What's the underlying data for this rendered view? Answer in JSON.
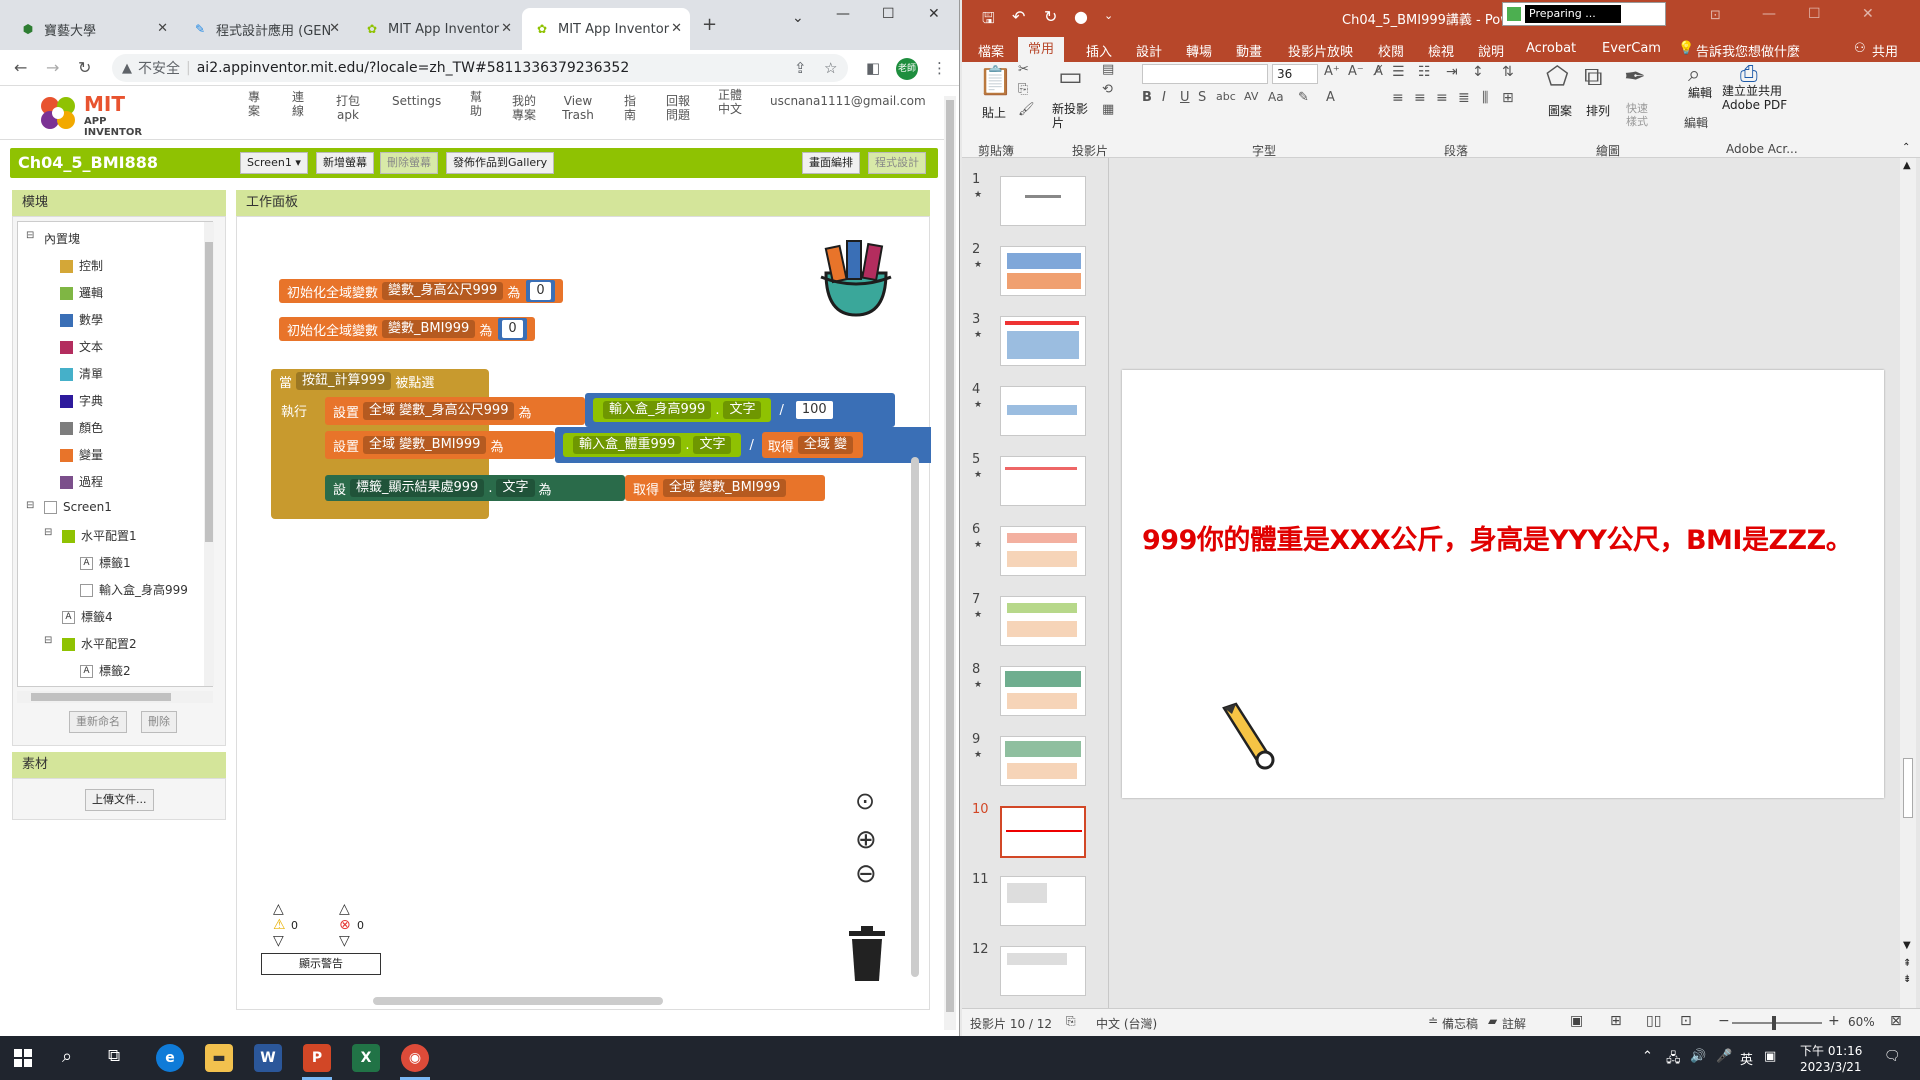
{
  "chrome": {
    "tabs": [
      {
        "label": "寶藝大學"
      },
      {
        "label": "程式設計應用 (GEN"
      },
      {
        "label": "MIT App Inventor"
      },
      {
        "label": "MIT App Inventor"
      }
    ],
    "new_tab": "+",
    "url": "ai2.appinventor.mit.edu/?locale=zh_TW#5811336379236352",
    "insecure": "不安全",
    "profile": "老師"
  },
  "ai": {
    "logo_main": "MIT",
    "logo_sub": "APP INVENTOR",
    "menu": [
      "專案",
      "連線",
      "打包apk",
      "Settings",
      "幫助",
      "我的專案",
      "View Trash",
      "指南",
      "回報問題",
      "正體中文"
    ],
    "email": "uscnana1111@gmail.com",
    "project_name": "Ch04_5_BMI888",
    "screen_select": "Screen1 ▾",
    "add_screen": "新增螢幕",
    "remove_screen": "刪除螢幕",
    "publish": "發佈作品到Gallery",
    "designer": "畫面編排",
    "blocks_btn": "程式設計",
    "blocks_panel_title": "模塊",
    "workspace_title": "工作面板",
    "tree": {
      "builtin": "內置塊",
      "categories": [
        {
          "label": "控制",
          "color": "#d4a737"
        },
        {
          "label": "邏輯",
          "color": "#7fb644"
        },
        {
          "label": "數學",
          "color": "#3a6fb6"
        },
        {
          "label": "文本",
          "color": "#b32d5e"
        },
        {
          "label": "清單",
          "color": "#45b0c9"
        },
        {
          "label": "字典",
          "color": "#2d1a9c"
        },
        {
          "label": "顏色",
          "color": "#7d7d7d"
        },
        {
          "label": "變量",
          "color": "#e8742a"
        },
        {
          "label": "過程",
          "color": "#7b4f8b"
        }
      ],
      "screen": "Screen1",
      "components": [
        "水平配置1",
        "標籤1",
        "輸入盒_身高999",
        "標籤4",
        "水平配置2",
        "標籤2"
      ]
    },
    "rename": "重新命名",
    "delete": "刪除",
    "media_title": "素材",
    "upload": "上傳文件...",
    "warn_count": "0",
    "error_count": "0",
    "show_warnings": "顯示警告",
    "blocks": {
      "init_global": "初始化全域變數",
      "var_height": "變數_身高公尺999",
      "as": "為",
      "zero": "0",
      "var_bmi": "變數_BMI999",
      "when": "當",
      "button": "按鈕_計算999",
      "clicked": "被點選",
      "do": "執行",
      "set": "設置",
      "global_height": "全域 變數_身高公尺999",
      "input_height": "輸入盒_身高999",
      "text": "文字",
      "divide": "/",
      "hundred": "100",
      "global_bmi": "全域 變數_BMI999",
      "input_weight": "輸入盒_體重999",
      "get": "取得",
      "global_trunc": "全域 變",
      "set_short": "設",
      "label_result": "標籤_顯示結果處999",
      "get_global_bmi": "全域 變數_BMI999"
    }
  },
  "ppt": {
    "title": "Ch04_5_BMI999講義 - Pow",
    "preparing": "Preparing ...",
    "menu": [
      "檔案",
      "常用",
      "插入",
      "設計",
      "轉場",
      "動畫",
      "投影片放映",
      "校閱",
      "檢視",
      "說明",
      "Acrobat",
      "EverCam"
    ],
    "tell_me": "告訴我您想做什麼",
    "share": "共用",
    "groups": [
      "剪貼簿",
      "投影片",
      "字型",
      "段落",
      "繪圖",
      "編輯",
      "Adobe Acr..."
    ],
    "paste": "貼上",
    "new_slide": "新投影片",
    "shapes": "圖案",
    "arrange": "排列",
    "quick_styles": "快速樣式",
    "edit": "編輯",
    "adobe": "建立並共用 Adobe PDF",
    "font_size": "36",
    "slides": [
      "1",
      "2",
      "3",
      "4",
      "5",
      "6",
      "7",
      "8",
      "9",
      "10",
      "11",
      "12"
    ],
    "slide_text": "999你的體重是XXX公斤，身高是YYY公尺，BMI是ZZZ。",
    "status_slide": "投影片 10 / 12",
    "status_lang": "中文 (台灣)",
    "notes": "備忘稿",
    "comments": "註解",
    "zoom": "60%"
  },
  "taskbar": {
    "time": "下午 01:16",
    "date": "2023/3/21",
    "ime": "英"
  }
}
